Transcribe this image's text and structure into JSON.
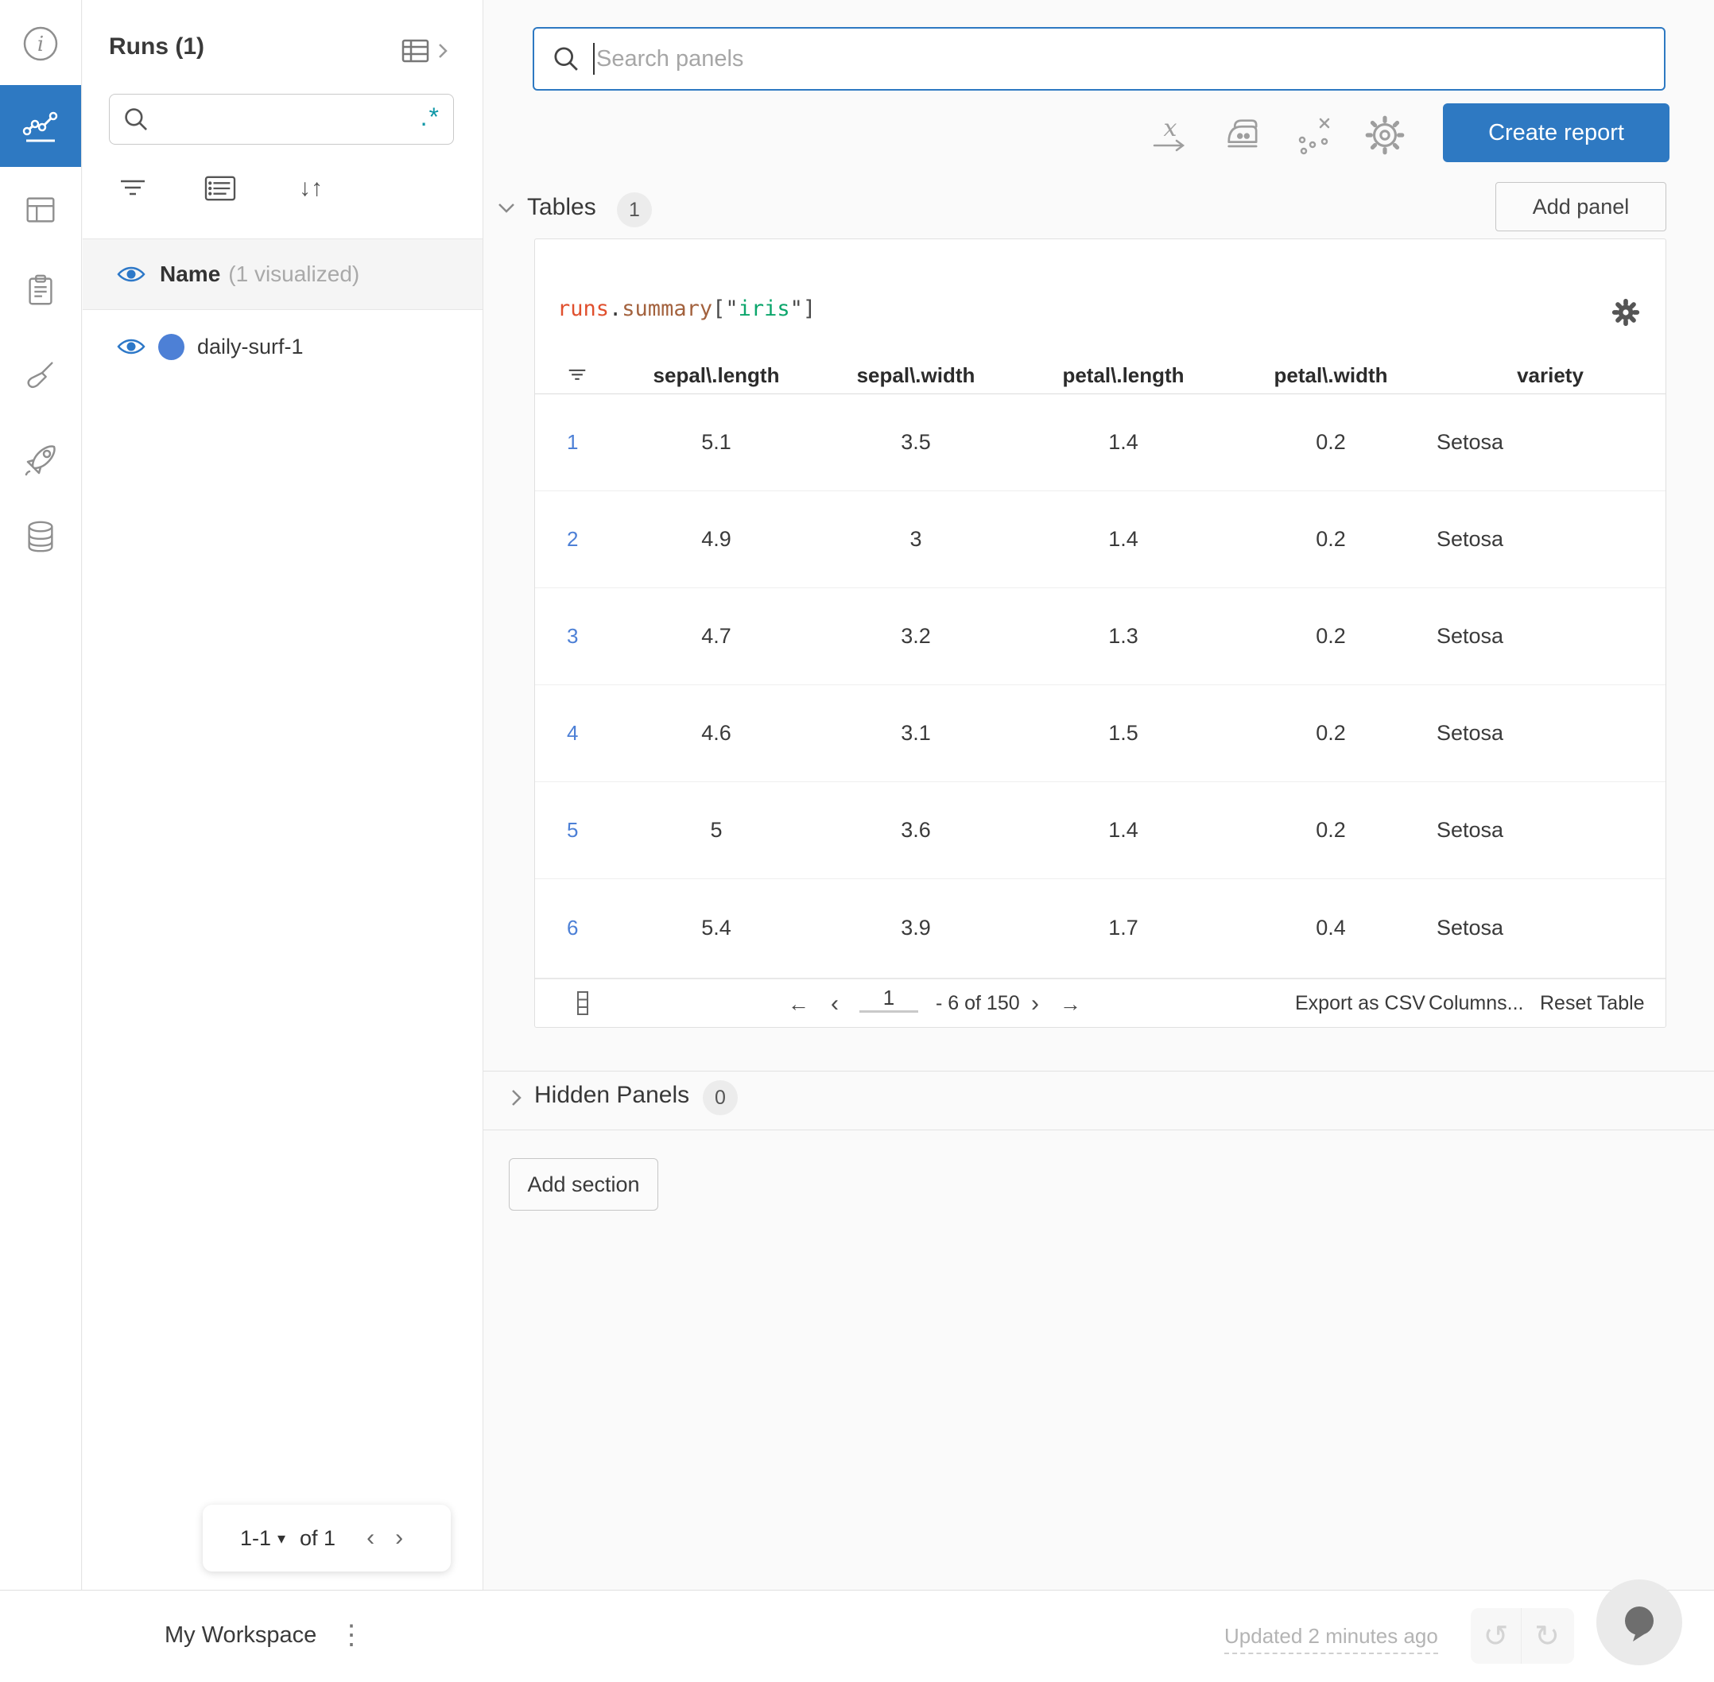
{
  "colors": {
    "accent_blue": "#2e79c2",
    "run_dot_blue": "#4d80d6",
    "regex_teal": "#0e97a7",
    "expr_runs": "#e0502e",
    "expr_summary": "#a3623e",
    "expr_string_green": "#0ca66c"
  },
  "icons": {
    "regex": ".*",
    "sort": "↓↑",
    "dropdown": "▾",
    "prev": "‹",
    "next": "›",
    "first": "←",
    "last": "→",
    "kebab": "⋮",
    "undo": "↺",
    "redo": "↻",
    "x_axis_label": "x"
  },
  "runs_panel": {
    "title": "Runs (1)",
    "search_value": "",
    "header_row": {
      "name_label": "Name",
      "visualized_label": "(1 visualized)"
    },
    "runs": [
      {
        "name": "daily-surf-1"
      }
    ],
    "pagination": {
      "range": "1-1",
      "of": "of 1"
    }
  },
  "toolbar": {
    "search_placeholder": "Search panels",
    "create_report_label": "Create report"
  },
  "sections": {
    "tables": {
      "label": "Tables",
      "count": "1",
      "add_panel_label": "Add panel"
    },
    "hidden": {
      "label": "Hidden Panels",
      "count": "0"
    },
    "add_section_label": "Add section"
  },
  "table_panel": {
    "expr": {
      "runs": "runs",
      "dot": ".",
      "summary": "summary",
      "open": "[\"",
      "string": "iris",
      "close": "\"]"
    },
    "columns": [
      "sepal\\.length",
      "sepal\\.width",
      "petal\\.length",
      "petal\\.width",
      "variety"
    ],
    "rows": [
      {
        "index": "1",
        "sepal_length": "5.1",
        "sepal_width": "3.5",
        "petal_length": "1.4",
        "petal_width": "0.2",
        "variety": "Setosa"
      },
      {
        "index": "2",
        "sepal_length": "4.9",
        "sepal_width": "3",
        "petal_length": "1.4",
        "petal_width": "0.2",
        "variety": "Setosa"
      },
      {
        "index": "3",
        "sepal_length": "4.7",
        "sepal_width": "3.2",
        "petal_length": "1.3",
        "petal_width": "0.2",
        "variety": "Setosa"
      },
      {
        "index": "4",
        "sepal_length": "4.6",
        "sepal_width": "3.1",
        "petal_length": "1.5",
        "petal_width": "0.2",
        "variety": "Setosa"
      },
      {
        "index": "5",
        "sepal_length": "5",
        "sepal_width": "3.6",
        "petal_length": "1.4",
        "petal_width": "0.2",
        "variety": "Setosa"
      },
      {
        "index": "6",
        "sepal_length": "5.4",
        "sepal_width": "3.9",
        "petal_length": "1.7",
        "petal_width": "0.4",
        "variety": "Setosa"
      }
    ],
    "footer": {
      "page": "1",
      "range": "- 6 of 150",
      "export_label": "Export as CSV",
      "columns_label": "Columns...",
      "reset_label": "Reset Table"
    }
  },
  "bottom_bar": {
    "workspace_label": "My Workspace",
    "updated_label": "Updated 2 minutes ago"
  }
}
